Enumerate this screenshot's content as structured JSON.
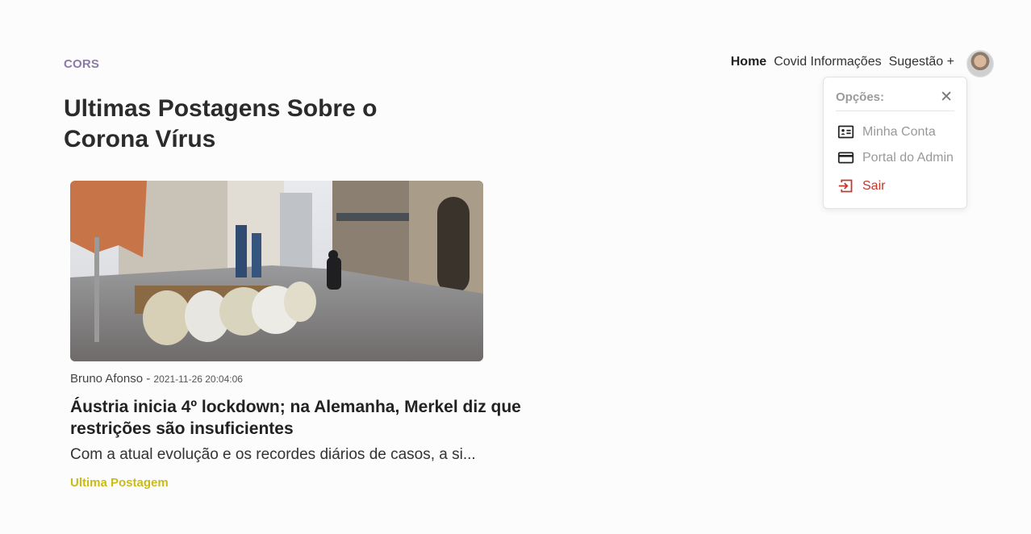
{
  "brand": "CORS",
  "page_title": "Ultimas Postagens Sobre o Corona Vírus",
  "nav": {
    "items": [
      {
        "label": "Home"
      },
      {
        "label": "Covid Informações"
      },
      {
        "label": "Sugestão +"
      }
    ]
  },
  "dropdown": {
    "title": "Opções:",
    "close_glyph": "✕",
    "items": [
      {
        "label": "Minha Conta",
        "icon": "id-card-icon"
      },
      {
        "label": "Portal do Admin",
        "icon": "credit-card-icon"
      },
      {
        "label": "Sair",
        "icon": "logout-icon"
      }
    ]
  },
  "post": {
    "author": "Bruno Afonso",
    "separator": " - ",
    "date": "2021-11-26 20:04:06",
    "title": "Áustria inicia 4º lockdown; na Alemanha, Merkel diz que restrições são insuficientes",
    "excerpt": "Com a atual evolução e os recordes diários de casos, a si...",
    "badge": "Ultima Postagem"
  },
  "colors": {
    "brand": "#8a7aa8",
    "badge": "#c9bb1a",
    "logout": "#c0392b"
  }
}
